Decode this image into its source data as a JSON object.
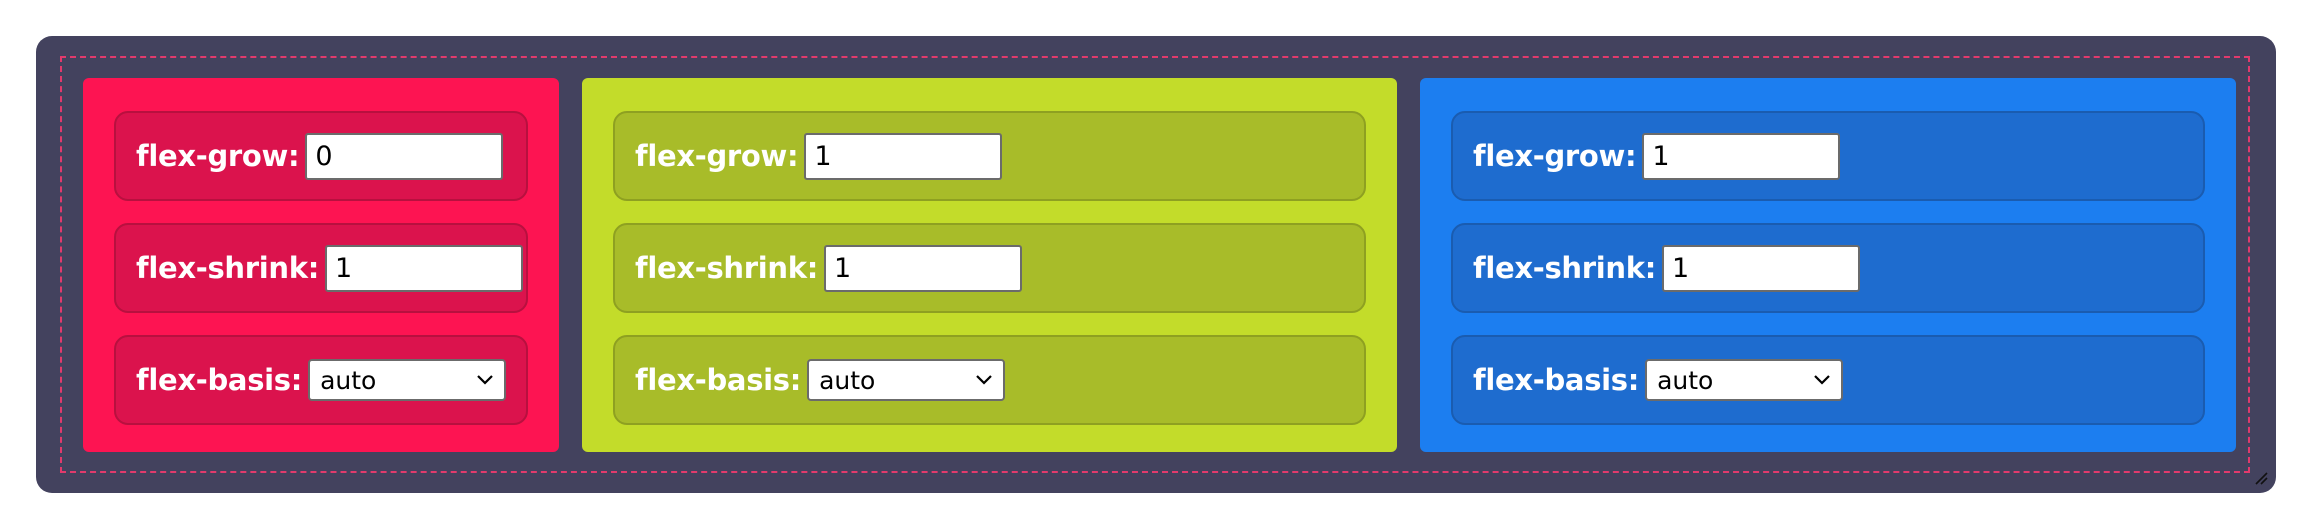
{
  "colors": {
    "frame_bg": "#43425e",
    "dashed_border": "#e23a6c",
    "item1_bg": "#fd1452",
    "item1_row": "#db134d",
    "item2_bg": "#c3dc2a",
    "item2_row": "#a8bc29",
    "item3_bg": "#1c7ef0",
    "item3_row": "#1e6ccf"
  },
  "items": [
    {
      "grow_label": "flex-grow:",
      "grow_value": "0",
      "shrink_label": "flex-shrink:",
      "shrink_value": "1",
      "basis_label": "flex-basis:",
      "basis_value": "auto"
    },
    {
      "grow_label": "flex-grow:",
      "grow_value": "1",
      "shrink_label": "flex-shrink:",
      "shrink_value": "1",
      "basis_label": "flex-basis:",
      "basis_value": "auto"
    },
    {
      "grow_label": "flex-grow:",
      "grow_value": "1",
      "shrink_label": "flex-shrink:",
      "shrink_value": "1",
      "basis_label": "flex-basis:",
      "basis_value": "auto"
    }
  ],
  "icons": {
    "dropdown": "chevron-down-icon",
    "resize": "resize-handle-icon"
  }
}
